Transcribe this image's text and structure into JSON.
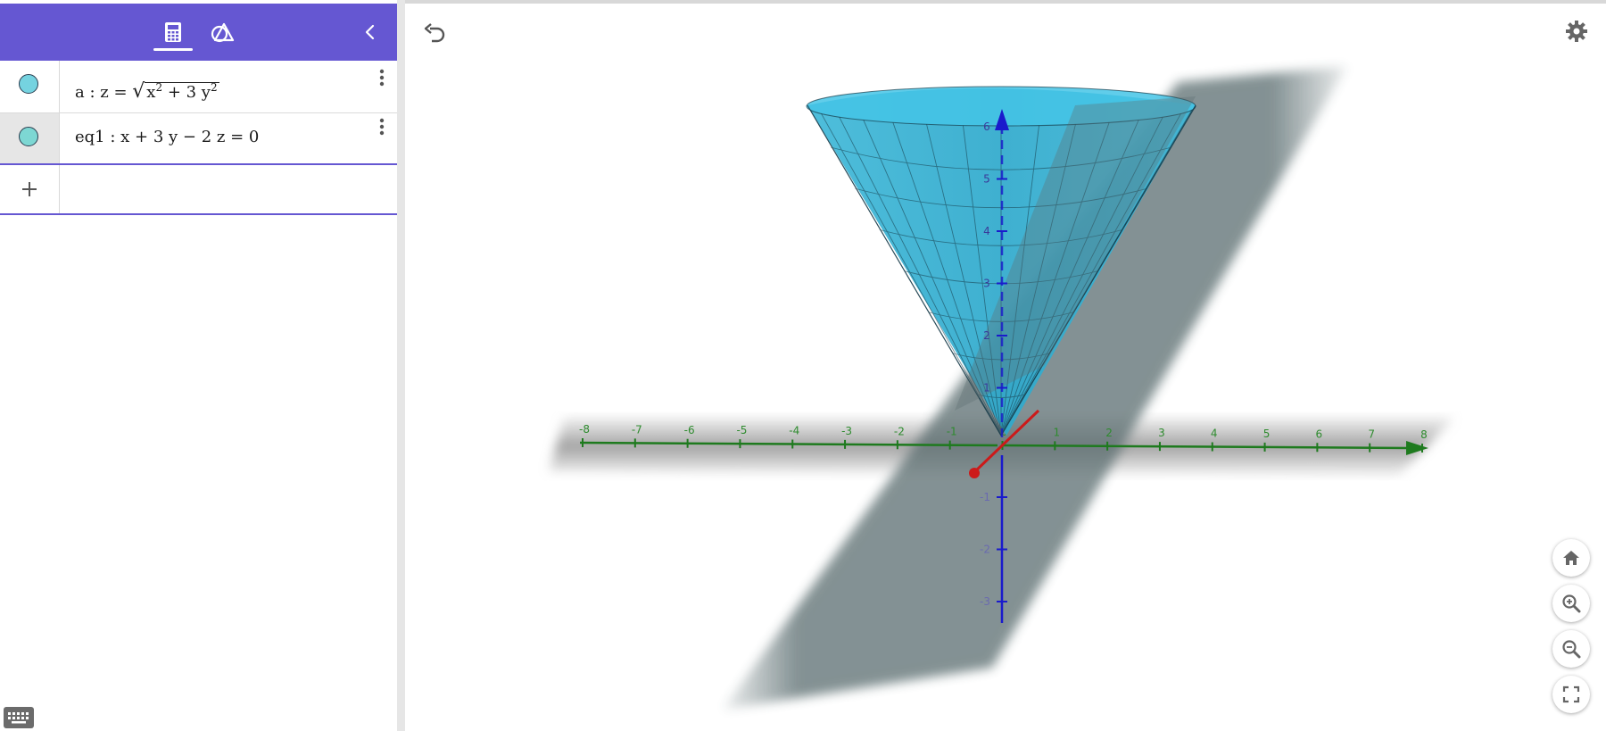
{
  "header": {
    "tabs": [
      {
        "icon": "calculator-icon",
        "active": true
      },
      {
        "icon": "geometry-tools-icon",
        "active": false
      }
    ],
    "collapse_icon": "chevron-left-icon",
    "accent_color": "#6557d2"
  },
  "algebra": {
    "rows": [
      {
        "label": "a",
        "sep": " : ",
        "lhs": "z = ",
        "radicand_base1": "x",
        "exp1": "2",
        "middle": " + 3 y",
        "exp2": "2",
        "color": "#75d3e0"
      },
      {
        "label": "eq1",
        "sep": " : ",
        "expression": "x + 3 y − 2 z = 0",
        "color": "#7dd7d3"
      }
    ],
    "input_placeholder": "",
    "add_icon": "plus-icon"
  },
  "graphics": {
    "x_ticks": [
      "-8",
      "-7",
      "-6",
      "-5",
      "-4",
      "-3",
      "-2",
      "-1",
      "0",
      "1",
      "2",
      "3",
      "4",
      "5",
      "6",
      "7",
      "8"
    ],
    "z_ticks_upper": [
      "6",
      "5",
      "4",
      "3",
      "2",
      "1"
    ],
    "z_ticks_lower": [
      "-1",
      "-2",
      "-3"
    ],
    "colors": {
      "cone": "#2eb5d8",
      "plane": "#5a6f72",
      "x_axis": "#1e7a1e",
      "z_axis": "#1a1acc",
      "y_axis": "#cc1a1a"
    }
  },
  "toolbar": {
    "undo_icon": "undo-icon",
    "settings_icon": "gear-icon",
    "home_icon": "home-icon",
    "zoom_in_icon": "zoom-in-icon",
    "zoom_out_icon": "zoom-out-icon",
    "fullscreen_icon": "fullscreen-icon"
  }
}
